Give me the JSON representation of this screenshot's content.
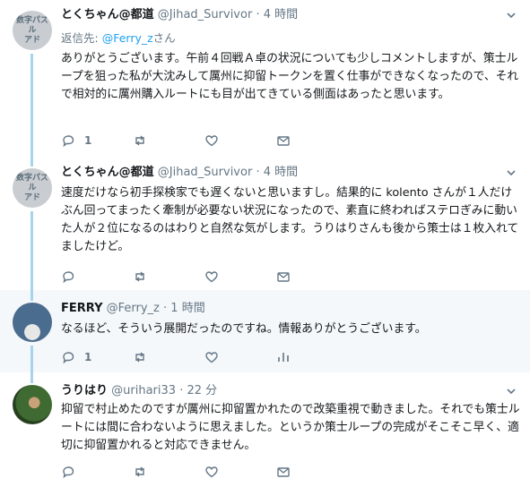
{
  "tweets": [
    {
      "name": "とくちゃん@都道",
      "handle": "@Jihad_Survivor",
      "time": "4 時間",
      "avatar_text": "数字パズル\nアド",
      "reply_label": "返信先:",
      "reply_to": "@Ferry_z",
      "reply_suffix": "さん",
      "text": "ありがとうございます。午前４回戦Ａ卓の状況についても少しコメントしますが、策士ループを狙った私が大沈みして厲州に抑留トークンを置く仕事ができなくなったので、それで相対的に厲州購入ルートにも目が出てきている側面はあったと思います。",
      "reply_count": "1"
    },
    {
      "name": "とくちゃん@都道",
      "handle": "@Jihad_Survivor",
      "time": "4 時間",
      "avatar_text": "数字パズル\nアド",
      "text": "速度だけなら初手探検家でも遅くないと思いますし。結果的に kolento さんが１人だけぶん回ってまったく牽制が必要ない状況になったので、素直に終わればステロぎみに動いた人が２位になるのはわりと自然な気がします。うりはりさんも後から策士は１枚入れてましたけど。",
      "reply_count": ""
    },
    {
      "name": "FERRY",
      "handle": "@Ferry_z",
      "time": "1 時間",
      "text": "なるほど、そういう展開だったのですね。情報ありがとうございます。",
      "reply_count": "1"
    },
    {
      "name": "うりはり",
      "handle": "@urihari33",
      "time": "22 分",
      "text": "抑留で村止めたのですが厲州に抑留置かれたので改築重視で動きました。それでも策士ルートには間に合わないように思えました。というか策士ループの完成がそこそこ早く、適切に抑留置かれると対応できません。",
      "reply_count": ""
    }
  ],
  "dot": "·",
  "icons": [
    "chevron-down-icon",
    "reply-icon",
    "retweet-icon",
    "like-icon",
    "message-icon",
    "analytics-icon"
  ],
  "colors": {
    "accent": "#1da1f2",
    "thread_line": "#a5d4ec",
    "muted": "#657786",
    "highlight_bg": "#f5f8fa"
  }
}
